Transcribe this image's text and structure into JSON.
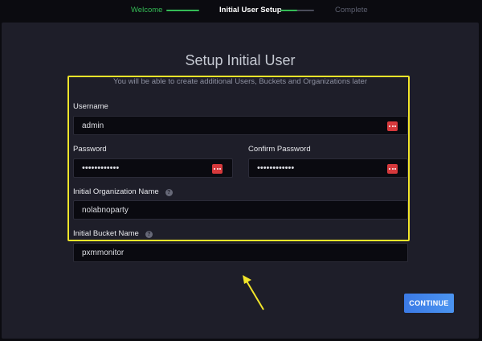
{
  "stepper": {
    "steps": [
      {
        "label": "Welcome",
        "state": "done"
      },
      {
        "label": "Initial User Setup",
        "state": "active"
      },
      {
        "label": "Complete",
        "state": "pending"
      }
    ],
    "colors": {
      "done": "#34bb55",
      "active": "#ffffff",
      "pending": "#5d6070"
    },
    "active_progress": 0.5
  },
  "page": {
    "title": "Setup Initial User",
    "subtitle": "You will be able to create additional Users, Buckets and Organizations later"
  },
  "form": {
    "username": {
      "label": "Username",
      "value": "admin"
    },
    "password": {
      "label": "Password",
      "value": "••••••••••••"
    },
    "confirm_password": {
      "label": "Confirm Password",
      "value": "••••••••••••"
    },
    "organization": {
      "label": "Initial Organization Name",
      "value": "nolabnoparty",
      "help_icon": "question-icon"
    },
    "bucket": {
      "label": "Initial Bucket Name",
      "value": "pxmmonitor",
      "help_icon": "question-icon"
    }
  },
  "highlight_color": "#f2e52a",
  "continue_label": "CONTINUE"
}
